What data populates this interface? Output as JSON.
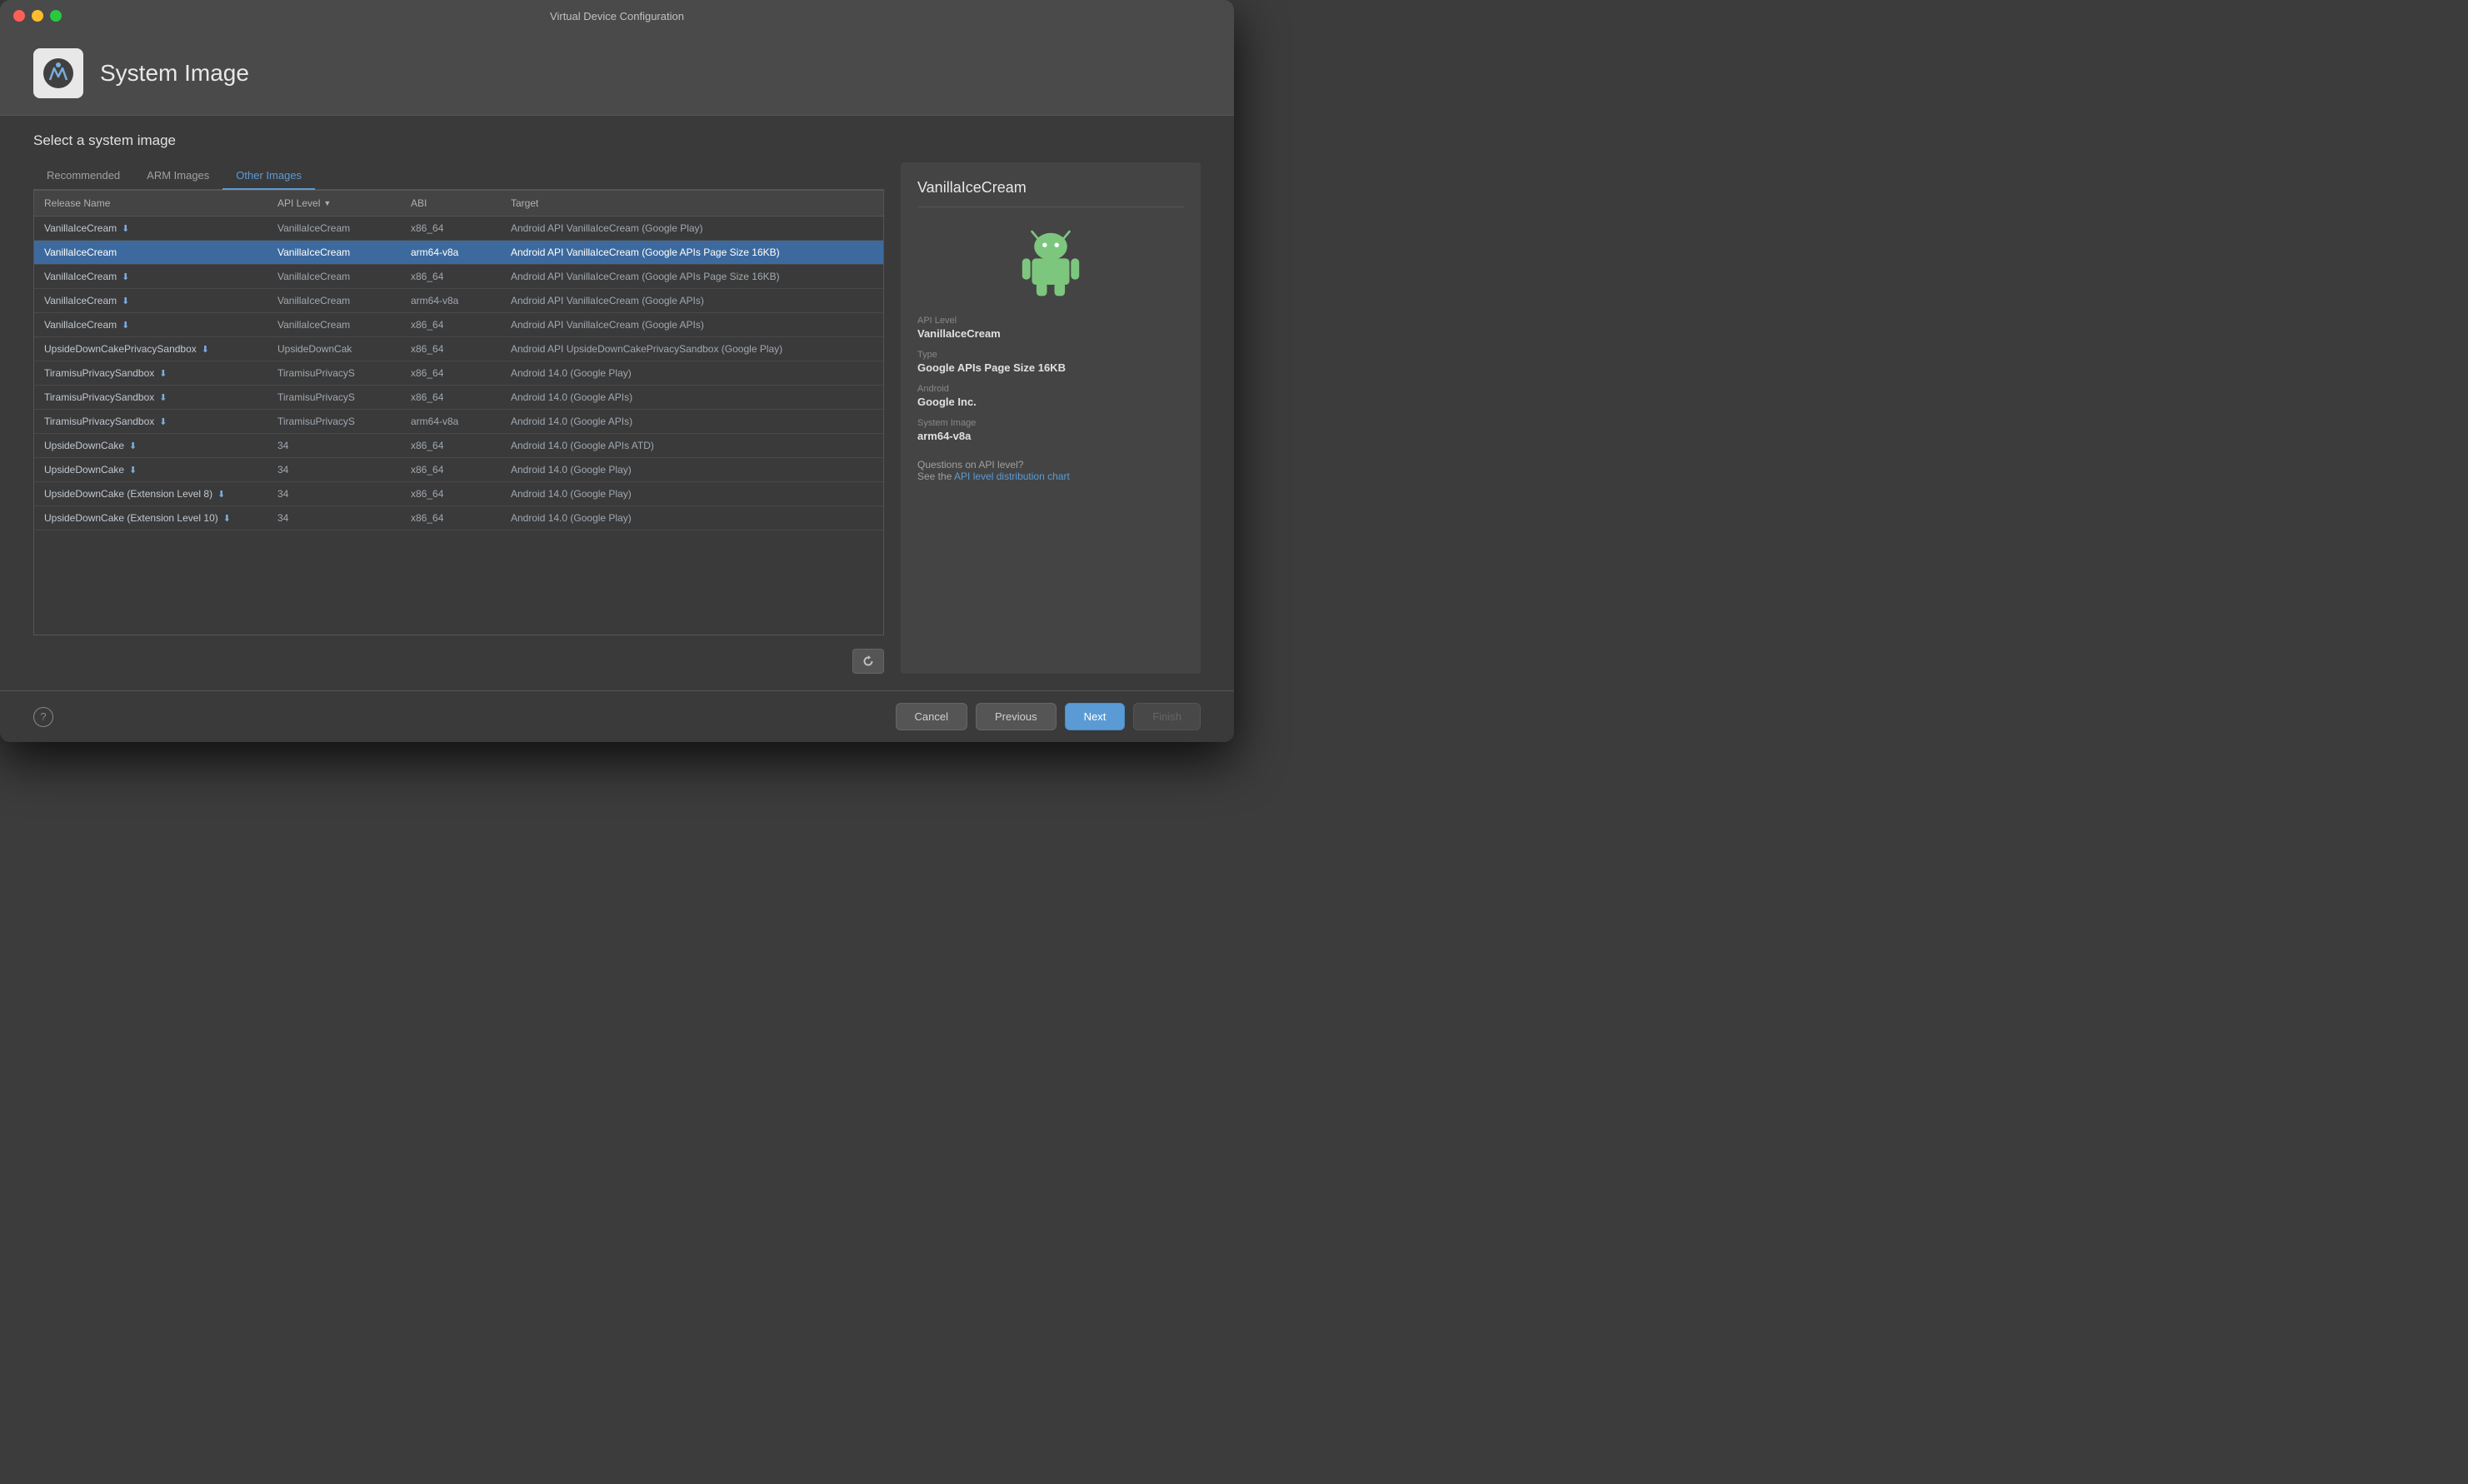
{
  "window": {
    "title": "Virtual Device Configuration"
  },
  "header": {
    "title": "System Image",
    "icon_alt": "Android Studio icon"
  },
  "main": {
    "section_title": "Select a system image",
    "tabs": [
      {
        "id": "recommended",
        "label": "Recommended",
        "active": false
      },
      {
        "id": "arm-images",
        "label": "ARM Images",
        "active": false
      },
      {
        "id": "other-images",
        "label": "Other Images",
        "active": true
      }
    ],
    "table": {
      "columns": [
        {
          "id": "release-name",
          "label": "Release Name",
          "sortable": false
        },
        {
          "id": "api-level",
          "label": "API Level",
          "sortable": true
        },
        {
          "id": "abi",
          "label": "ABI",
          "sortable": false
        },
        {
          "id": "target",
          "label": "Target",
          "sortable": false
        }
      ],
      "rows": [
        {
          "release_name": "VanillaIceCream",
          "has_download": true,
          "api_level": "VanillaIceCream",
          "abi": "x86_64",
          "target": "Android API VanillaIceCream (Google Play)",
          "selected": false
        },
        {
          "release_name": "VanillaIceCream",
          "has_download": false,
          "api_level": "VanillaIceCream",
          "abi": "arm64-v8a",
          "target": "Android API VanillaIceCream (Google APIs Page Size 16KB)",
          "selected": true
        },
        {
          "release_name": "VanillaIceCream",
          "has_download": true,
          "api_level": "VanillaIceCream",
          "abi": "x86_64",
          "target": "Android API VanillaIceCream (Google APIs Page Size 16KB)",
          "selected": false
        },
        {
          "release_name": "VanillaIceCream",
          "has_download": true,
          "api_level": "VanillaIceCream",
          "abi": "arm64-v8a",
          "target": "Android API VanillaIceCream (Google APIs)",
          "selected": false
        },
        {
          "release_name": "VanillaIceCream",
          "has_download": true,
          "api_level": "VanillaIceCream",
          "abi": "x86_64",
          "target": "Android API VanillaIceCream (Google APIs)",
          "selected": false
        },
        {
          "release_name": "UpsideDownCakePrivacySandbox",
          "has_download": true,
          "api_level": "UpsideDownCak",
          "abi": "x86_64",
          "target": "Android API UpsideDownCakePrivacySandbox (Google Play)",
          "selected": false
        },
        {
          "release_name": "TiramisuPrivacySandbox",
          "has_download": true,
          "api_level": "TiramisuPrivacyS",
          "abi": "x86_64",
          "target": "Android 14.0 (Google Play)",
          "selected": false
        },
        {
          "release_name": "TiramisuPrivacySandbox",
          "has_download": true,
          "api_level": "TiramisuPrivacyS",
          "abi": "x86_64",
          "target": "Android 14.0 (Google APIs)",
          "selected": false
        },
        {
          "release_name": "TiramisuPrivacySandbox",
          "has_download": true,
          "api_level": "TiramisuPrivacyS",
          "abi": "arm64-v8a",
          "target": "Android 14.0 (Google APIs)",
          "selected": false
        },
        {
          "release_name": "UpsideDownCake",
          "has_download": true,
          "api_level": "34",
          "abi": "x86_64",
          "target": "Android 14.0 (Google APIs ATD)",
          "selected": false
        },
        {
          "release_name": "UpsideDownCake",
          "has_download": true,
          "api_level": "34",
          "abi": "x86_64",
          "target": "Android 14.0 (Google Play)",
          "selected": false
        },
        {
          "release_name": "UpsideDownCake (Extension Level 8)",
          "has_download": true,
          "api_level": "34",
          "abi": "x86_64",
          "target": "Android 14.0 (Google Play)",
          "selected": false
        },
        {
          "release_name": "UpsideDownCake (Extension Level 10)",
          "has_download": true,
          "api_level": "34",
          "abi": "x86_64",
          "target": "Android 14.0 (Google Play)",
          "selected": false
        }
      ]
    }
  },
  "detail": {
    "name": "VanillaIceCream",
    "api_level_label": "API Level",
    "api_level_value": "VanillaIceCream",
    "type_label": "Type",
    "type_value": "Google APIs Page Size 16KB",
    "android_label": "Android",
    "android_value": "Google Inc.",
    "system_image_label": "System Image",
    "system_image_value": "arm64-v8a",
    "api_question": "Questions on API level?",
    "api_see": "See the",
    "api_link_text": "API level distribution chart"
  },
  "footer": {
    "help_label": "?",
    "cancel_label": "Cancel",
    "previous_label": "Previous",
    "next_label": "Next",
    "finish_label": "Finish"
  }
}
